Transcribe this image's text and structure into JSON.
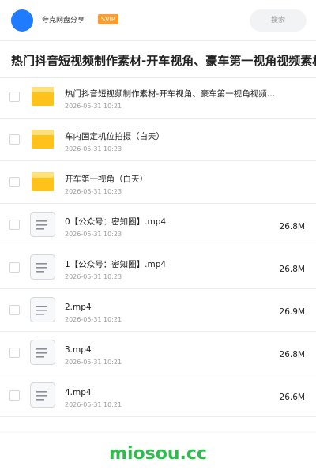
{
  "header": {
    "user_name": "夸克网盘分享",
    "badge": "SVIP",
    "search_label": "搜索"
  },
  "title": "热门抖音短视频制作素材-开车视角、豪车第一视角视频素材",
  "files": [
    {
      "name": "热门抖音短视频制作素材-开车视角、豪车第一视角视频素材",
      "date": "2026-05-31 10:21",
      "size": "",
      "type": "folder"
    },
    {
      "name": "车内固定机位拍摄（白天）",
      "date": "2026-05-31 10:23",
      "size": "",
      "type": "folder"
    },
    {
      "name": "开车第一视角（白天）",
      "date": "2026-05-31 10:23",
      "size": "",
      "type": "folder"
    },
    {
      "name": "0【公众号：密知圈】.mp4",
      "date": "2026-05-31 10:23",
      "size": "26.8M",
      "type": "video"
    },
    {
      "name": "1【公众号：密知圈】.mp4",
      "date": "2026-05-31 10:23",
      "size": "26.8M",
      "type": "video"
    },
    {
      "name": "2.mp4",
      "date": "2026-05-31 10:21",
      "size": "26.9M",
      "type": "video"
    },
    {
      "name": "3.mp4",
      "date": "2026-05-31 10:21",
      "size": "26.8M",
      "type": "video"
    },
    {
      "name": "4.mp4",
      "date": "2026-05-31 10:21",
      "size": "26.6M",
      "type": "video"
    }
  ],
  "watermark": "miosou.cc",
  "colors": {
    "accent": "#1f7bff",
    "badge": "#ff9c2a",
    "folder": "#ffc21a",
    "watermark": "#2ebd4c"
  }
}
